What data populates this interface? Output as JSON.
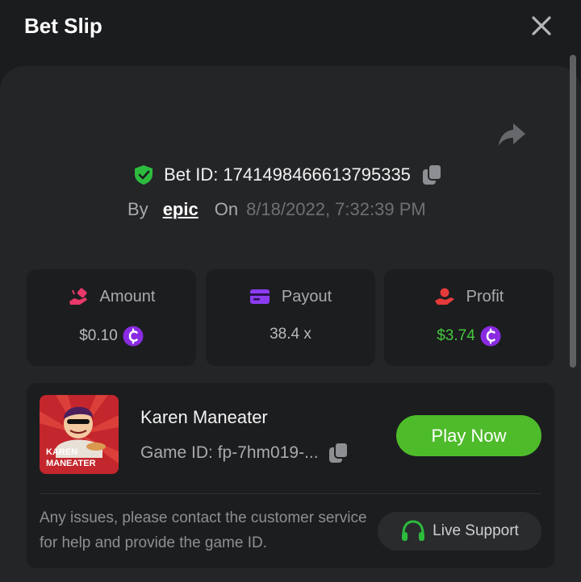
{
  "header": {
    "title": "Bet Slip"
  },
  "bet": {
    "id_text": "Bet ID: 1741498466613795335",
    "by_label": "By",
    "username": "epic",
    "on_label": "On",
    "date": "8/18/2022, 7:32:39 PM"
  },
  "stats": [
    {
      "label": "Amount",
      "value": "$0.10",
      "icon": "hand-coins-icon"
    },
    {
      "label": "Payout",
      "value": "38.4 x",
      "icon": "card-icon"
    },
    {
      "label": "Profit",
      "value": "$3.74",
      "icon": "hand-heart-icon"
    }
  ],
  "game": {
    "name": "Karen Maneater",
    "game_id": "Game ID: fp-7hm019-...",
    "play_label": "Play Now",
    "thumb_text": {
      "line1": "KAREN",
      "line2": "MANEATER"
    }
  },
  "support": {
    "text": "Any issues, please contact the customer service for help and provide the game ID.",
    "button_label": "Live Support"
  },
  "colors": {
    "accent_green": "#4ebb2a",
    "profit_green": "#45c93c",
    "coin_purple": "#8a2be2",
    "panel_bg": "#242527",
    "card_bg": "#1c1d1f"
  }
}
